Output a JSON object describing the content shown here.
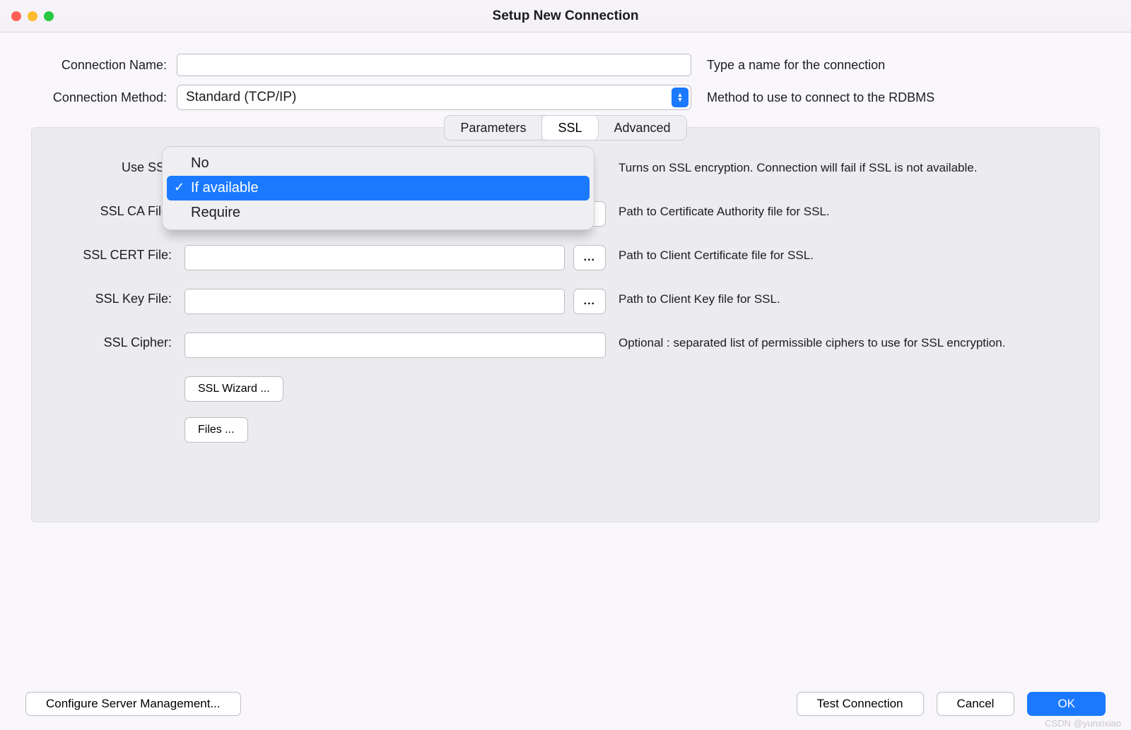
{
  "window_title": "Setup New Connection",
  "upper": {
    "name_label": "Connection Name:",
    "name_value": "",
    "name_helper": "Type a name for the connection",
    "method_label": "Connection Method:",
    "method_value": "Standard (TCP/IP)",
    "method_helper": "Method to use to connect to the RDBMS"
  },
  "tabs": {
    "parameters": "Parameters",
    "ssl": "SSL",
    "advanced": "Advanced",
    "active_index": 1
  },
  "ssl": {
    "use_label": "Use SSL",
    "use_helper": "Turns on SSL encryption. Connection will fail if SSL is not available.",
    "dropdown_options": [
      "No",
      "If available",
      "Require"
    ],
    "dropdown_selected_index": 1,
    "ca_label": "SSL CA File:",
    "ca_value": "",
    "ca_helper": "Path to Certificate Authority file for SSL.",
    "cert_label": "SSL CERT File:",
    "cert_value": "",
    "cert_helper": "Path to Client Certificate file for SSL.",
    "key_label": "SSL Key File:",
    "key_value": "",
    "key_helper": "Path to Client Key file for SSL.",
    "cipher_label": "SSL Cipher:",
    "cipher_value": "",
    "cipher_helper": "Optional : separated list of permissible ciphers to use for SSL encryption.",
    "wizard_btn": "SSL Wizard ...",
    "files_btn": "Files ...",
    "browse_label": "..."
  },
  "buttons": {
    "configure": "Configure Server Management...",
    "test": "Test Connection",
    "cancel": "Cancel",
    "ok": "OK"
  },
  "watermark": "CSDN @yunxixiao"
}
